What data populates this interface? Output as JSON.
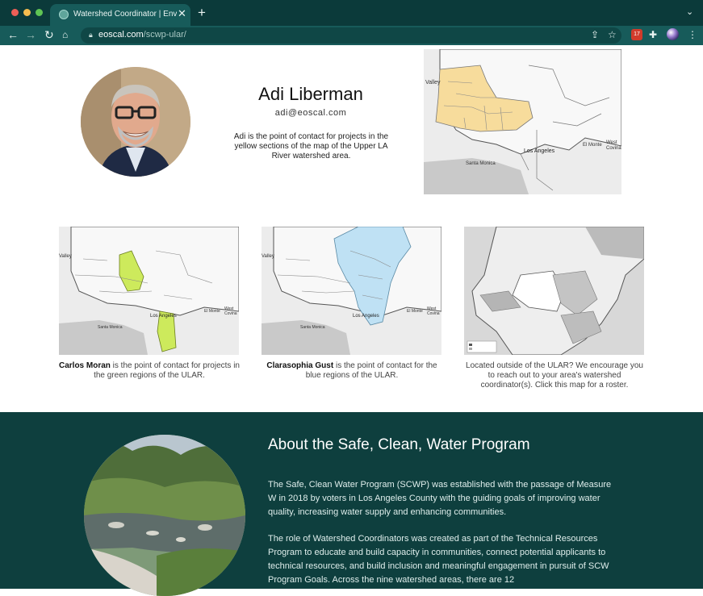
{
  "browser": {
    "tab_title": "Watershed Coordinator | Enviro",
    "url_host": "eoscal.com",
    "url_path": "/scwp-ular/",
    "ext_badge": "17"
  },
  "primary_coordinator": {
    "name": "Adi Liberman",
    "email": "adi@eoscal.com",
    "description": "Adi is the point of contact for projects in the yellow sections of the map of the Upper LA River watershed area."
  },
  "map_labels": {
    "valley": "Valley",
    "los_angeles": "Los Angeles",
    "el_monte": "El Monte",
    "west_covina": "West Covina",
    "santa_monica": "Santa Monica"
  },
  "coordinators": [
    {
      "name": "Carlos Moran",
      "text": " is the point of contact for projects in the green regions of the ULAR.",
      "color": "#cdea5c"
    },
    {
      "name": "Clarasophia Gust",
      "text": " is the point of contact for the blue regions of the ULAR.",
      "color": "#bfe1f4"
    }
  ],
  "roster_caption": "Located outside of the ULAR? We encourage you to reach out to your area's watershed coordinator(s). Click this map for a roster.",
  "about": {
    "title": "About the Safe, Clean, Water Program",
    "p1": "The Safe, Clean Water Program (SCWP) was established with the passage of Measure W in 2018 by voters in Los Angeles County with the guiding goals of improving water quality, increasing water supply and enhancing communities.",
    "p2": "The role of Watershed Coordinators was created as part of the Technical Resources Program to educate and build capacity in communities, connect potential applicants to technical resources, and build inclusion and meaningful engagement in pursuit of SCW Program Goals. Across the nine watershed areas, there are 12"
  },
  "colors": {
    "chrome_dark": "#0b3a3a",
    "chrome_tab": "#175b5a",
    "about_bg": "#0e3f3e",
    "yellow_region": "#f7dc9c"
  },
  "icons": [
    "back-icon",
    "forward-icon",
    "reload-icon",
    "home-icon",
    "lock-icon",
    "share-icon",
    "star-icon",
    "puzzle-icon",
    "menu-icon"
  ]
}
